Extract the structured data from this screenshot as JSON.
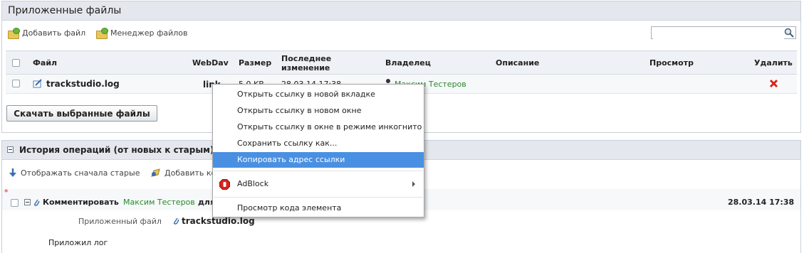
{
  "files_panel": {
    "title": "Приложенные файлы",
    "toolbar": {
      "add_file": "Добавить файл",
      "file_manager": "Менеджер файлов"
    },
    "search": {
      "placeholder": ""
    },
    "columns": {
      "file": "Файл",
      "webdav": "WebDav",
      "size": "Размер",
      "modified_line1": "Последнее",
      "modified_line2": "изменение",
      "owner": "Владелец",
      "description": "Описание",
      "preview": "Просмотр",
      "delete": "Удалить"
    },
    "rows": [
      {
        "file": "trackstudio.log",
        "webdav": "link",
        "size": "5.0 KB",
        "modified": "28.03.14 17:38",
        "owner": "Максим Тестеров",
        "description": "",
        "preview": ""
      }
    ],
    "download_button": "Скачать выбранные файлы"
  },
  "history_panel": {
    "title": "История операций (от новых к старым)",
    "toolbar": {
      "show_old_first": "Отображать сначала старые",
      "add_comment": "Добавить комментарий"
    },
    "entry": {
      "required_mark": "*",
      "action": "Комментировать",
      "author": "Максим Тестеров",
      "for": "для",
      "timestamp": "28.03.14 17:38",
      "attached_label": "Приложенный файл",
      "attached_file": "trackstudio.log",
      "comment": "Приложил лог"
    }
  },
  "context_menu": {
    "items": [
      {
        "label": "Открыть ссылку в новой вкладке"
      },
      {
        "label": "Открыть ссылку в новом окне"
      },
      {
        "label": "Открыть ссылку в окне в режиме инкогнито"
      },
      {
        "label": "Сохранить ссылку как..."
      },
      {
        "label": "Копировать адрес ссылки",
        "active": true
      },
      {
        "label": "AdBlock",
        "submenu": true
      },
      {
        "label": "Просмотр кода элемента"
      }
    ]
  },
  "colors": {
    "accent": "#4a90e2",
    "owner_link": "#2a8a2a",
    "delete": "#d9241c",
    "panel_header": "#e4e8ee"
  }
}
